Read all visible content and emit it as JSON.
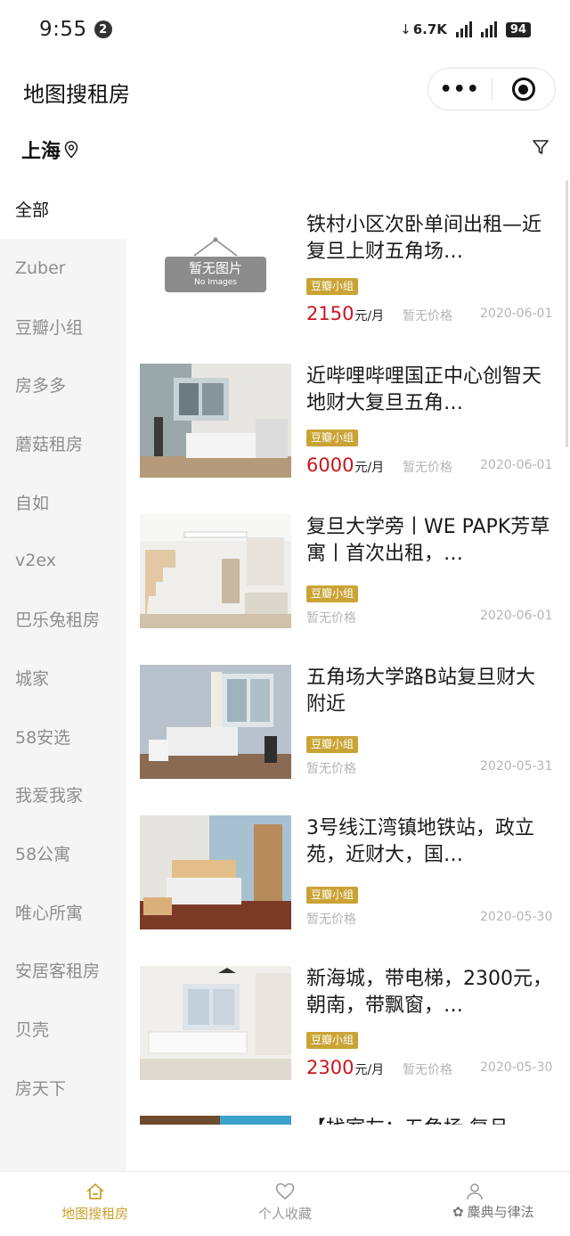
{
  "status_bar": {
    "time": "9:55",
    "notification_count": "2",
    "net_speed": "6.7K",
    "battery": "94"
  },
  "header": {
    "title": "地图搜租房",
    "more_label": "•••"
  },
  "city": {
    "name": "上海"
  },
  "sidebar": {
    "items": [
      {
        "label": "全部",
        "active": true
      },
      {
        "label": "Zuber"
      },
      {
        "label": "豆瓣小组"
      },
      {
        "label": "房多多"
      },
      {
        "label": "蘑菇租房"
      },
      {
        "label": "自如"
      },
      {
        "label": "v2ex"
      },
      {
        "label": "巴乐兔租房"
      },
      {
        "label": "城家"
      },
      {
        "label": "58安选"
      },
      {
        "label": "我爱我家"
      },
      {
        "label": "58公寓"
      },
      {
        "label": "唯心所寓"
      },
      {
        "label": "安居客租房"
      },
      {
        "label": "贝壳"
      },
      {
        "label": "房天下"
      }
    ]
  },
  "listings": [
    {
      "title": "铁村小区次卧单间出租—近复旦上财五角场…",
      "tag": "豆瓣小组",
      "price": "2150",
      "unit": "元/月",
      "no_price": "暂无价格",
      "date": "2020-06-01",
      "no_image_cn": "暂无图片",
      "no_image_en": "No Images"
    },
    {
      "title": "近哔哩哔哩国正中心创智天地财大复旦五角…",
      "tag": "豆瓣小组",
      "price": "6000",
      "unit": "元/月",
      "no_price": "暂无价格",
      "date": "2020-06-01"
    },
    {
      "title": "复旦大学旁丨WE PAPK芳草寓丨首次出租，…",
      "tag": "豆瓣小组",
      "no_price": "暂无价格",
      "date": "2020-06-01"
    },
    {
      "title": "五角场大学路B站复旦财大附近",
      "tag": "豆瓣小组",
      "no_price": "暂无价格",
      "date": "2020-05-31"
    },
    {
      "title": "3号线江湾镇地铁站，政立苑，近财大，国…",
      "tag": "豆瓣小组",
      "no_price": "暂无价格",
      "date": "2020-05-30"
    },
    {
      "title": "新海城，带电梯，2300元，朝南，带飘窗，…",
      "tag": "豆瓣小组",
      "price": "2300",
      "unit": "元/月",
      "no_price": "暂无价格",
      "date": "2020-05-30"
    },
    {
      "title": "【找室友：五角场 复旦…"
    }
  ],
  "tabbar": {
    "tabs": [
      {
        "label": "地图搜租房",
        "active": true
      },
      {
        "label": "个人收藏"
      },
      {
        "label": ""
      }
    ]
  },
  "watermark": "麋典与律法",
  "colors": {
    "accent": "#c9a02e",
    "price": "#c8161d",
    "tag": "#caa335"
  }
}
